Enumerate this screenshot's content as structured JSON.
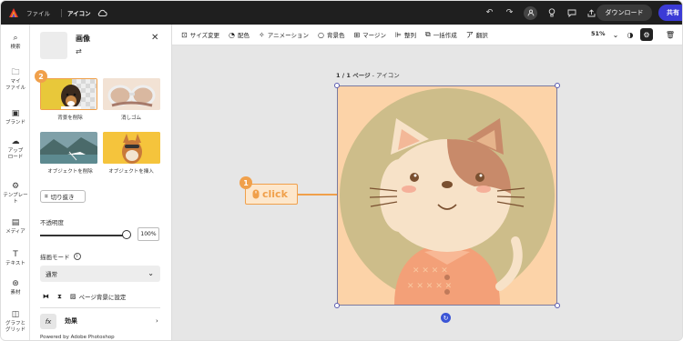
{
  "topbar": {
    "file_menu": "ファイル",
    "doc_title": "アイコン",
    "download_label": "ダウンロード",
    "share_label": "共有",
    "colors": {
      "background": "#1f1f1f",
      "share": "#3b3bd6",
      "logo": "#e8342c"
    }
  },
  "rail": {
    "items": [
      {
        "label": "検索",
        "icon": "search-icon"
      },
      {
        "label": "マイ\nファイル",
        "icon": "folder-icon"
      },
      {
        "label": "ブランド",
        "icon": "brand-icon"
      },
      {
        "label": "アップ\nロード",
        "icon": "upload-icon"
      },
      {
        "label": "テンプレー\nト",
        "icon": "template-icon"
      },
      {
        "label": "メディア",
        "icon": "media-icon"
      },
      {
        "label": "テキスト",
        "icon": "text-icon"
      },
      {
        "label": "素材",
        "icon": "elements-icon"
      },
      {
        "label": "グラフと\nグリッド",
        "icon": "chart-grid-icon"
      }
    ]
  },
  "panel": {
    "title": "画像",
    "close_icon": "close-icon",
    "tiles": [
      {
        "label": "背景を削除"
      },
      {
        "label": "消しゴム"
      },
      {
        "label": "オブジェクトを削除"
      },
      {
        "label": "オブジェクトを挿入"
      }
    ],
    "crop_label": "切り抜き",
    "opacity_label": "不透明度",
    "opacity_value": "100%",
    "opacity_level": 1.0,
    "blend_label": "描画モード",
    "blend_value": "通常",
    "page_bg_label": "ページ背景に設定",
    "effects_label": "効果",
    "effects_badge": "fx",
    "powered_by": "Powered by Adobe Photoshop"
  },
  "toolbar": {
    "tools": [
      {
        "label": "サイズ変更",
        "icon": "resize-icon"
      },
      {
        "label": "配色",
        "icon": "palette-icon"
      },
      {
        "label": "アニメーション",
        "icon": "animation-icon"
      },
      {
        "label": "背景色",
        "icon": "bg-color-icon"
      },
      {
        "label": "マージン",
        "icon": "margin-icon"
      },
      {
        "label": "整列",
        "icon": "align-icon"
      },
      {
        "label": "一括作成",
        "icon": "bulk-create-icon"
      },
      {
        "label": "翻訳",
        "icon": "translate-icon"
      }
    ],
    "zoom": "51%"
  },
  "canvas": {
    "page_indicator": "1 / 1 ページ",
    "page_name": "- アイコン",
    "annotation_click": "click",
    "badge_1": "1",
    "badge_2": "2",
    "accent": "#f0a04b"
  }
}
